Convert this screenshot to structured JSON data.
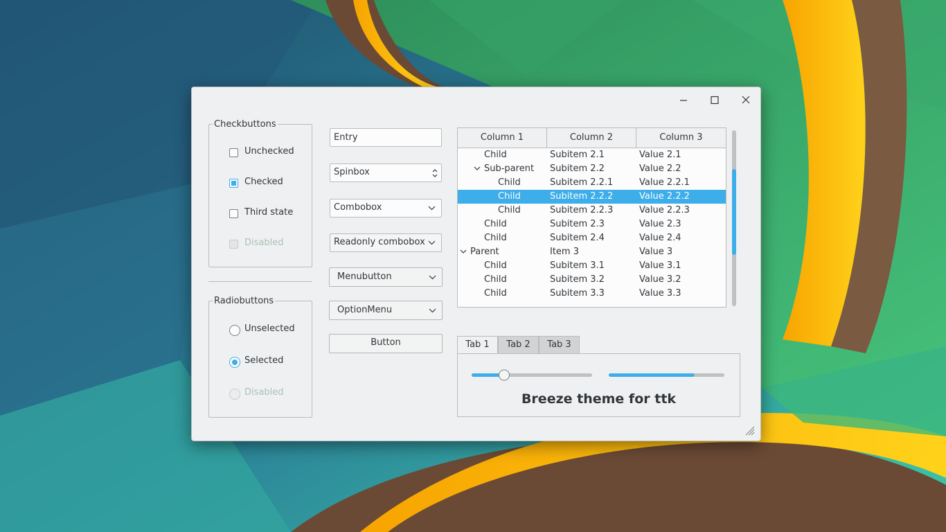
{
  "window": {
    "controls": {
      "minimize": "minimize-icon",
      "maximize": "maximize-icon",
      "close": "close-icon"
    }
  },
  "checkbuttons": {
    "title": "Checkbuttons",
    "items": [
      {
        "label": "Unchecked",
        "state": "unchecked"
      },
      {
        "label": "Checked",
        "state": "checked"
      },
      {
        "label": "Third state",
        "state": "unchecked"
      },
      {
        "label": "Disabled",
        "state": "disabled"
      }
    ]
  },
  "radiobuttons": {
    "title": "Radiobuttons",
    "items": [
      {
        "label": "Unselected",
        "state": "unselected"
      },
      {
        "label": "Selected",
        "state": "selected"
      },
      {
        "label": "Disabled",
        "state": "disabled"
      }
    ]
  },
  "widgets": {
    "entry": "Entry",
    "spinbox": "Spinbox",
    "combobox": "Combobox",
    "readonly_combobox": "Readonly combobox",
    "menubutton": "Menubutton",
    "optionmenu": "OptionMenu",
    "button": "Button"
  },
  "treeview": {
    "columns": [
      "Column 1",
      "Column 2",
      "Column 3"
    ],
    "rows": [
      {
        "indent": 1,
        "expander": false,
        "c1": "Child",
        "c2": "Subitem 2.1",
        "c3": "Value 2.1",
        "selected": false
      },
      {
        "indent": 1,
        "expander": true,
        "c1": "Sub-parent",
        "c2": "Subitem 2.2",
        "c3": "Value 2.2",
        "selected": false
      },
      {
        "indent": 2,
        "expander": false,
        "c1": "Child",
        "c2": "Subitem 2.2.1",
        "c3": "Value 2.2.1",
        "selected": false
      },
      {
        "indent": 2,
        "expander": false,
        "c1": "Child",
        "c2": "Subitem 2.2.2",
        "c3": "Value 2.2.2",
        "selected": true
      },
      {
        "indent": 2,
        "expander": false,
        "c1": "Child",
        "c2": "Subitem 2.2.3",
        "c3": "Value 2.2.3",
        "selected": false
      },
      {
        "indent": 1,
        "expander": false,
        "c1": "Child",
        "c2": "Subitem 2.3",
        "c3": "Value 2.3",
        "selected": false
      },
      {
        "indent": 1,
        "expander": false,
        "c1": "Child",
        "c2": "Subitem 2.4",
        "c3": "Value 2.4",
        "selected": false
      },
      {
        "indent": 0,
        "expander": true,
        "c1": "Parent",
        "c2": "Item 3",
        "c3": "Value 3",
        "selected": false
      },
      {
        "indent": 1,
        "expander": false,
        "c1": "Child",
        "c2": "Subitem 3.1",
        "c3": "Value 3.1",
        "selected": false
      },
      {
        "indent": 1,
        "expander": false,
        "c1": "Child",
        "c2": "Subitem 3.2",
        "c3": "Value 3.2",
        "selected": false
      },
      {
        "indent": 1,
        "expander": false,
        "c1": "Child",
        "c2": "Subitem 3.3",
        "c3": "Value 3.3",
        "selected": false
      }
    ],
    "scroll": {
      "thumb_start": 0.22,
      "thumb_end": 0.71
    }
  },
  "notebook": {
    "tabs": [
      "Tab 1",
      "Tab 2",
      "Tab 3"
    ],
    "active_tab": 0,
    "scale_value": 0.27,
    "progress_value": 0.74,
    "label": "Breeze theme for ttk"
  },
  "colors": {
    "accent": "#3daee9",
    "window_bg": "#eff0f1",
    "text": "#31363b",
    "disabled_text": "#a9c2b5"
  }
}
